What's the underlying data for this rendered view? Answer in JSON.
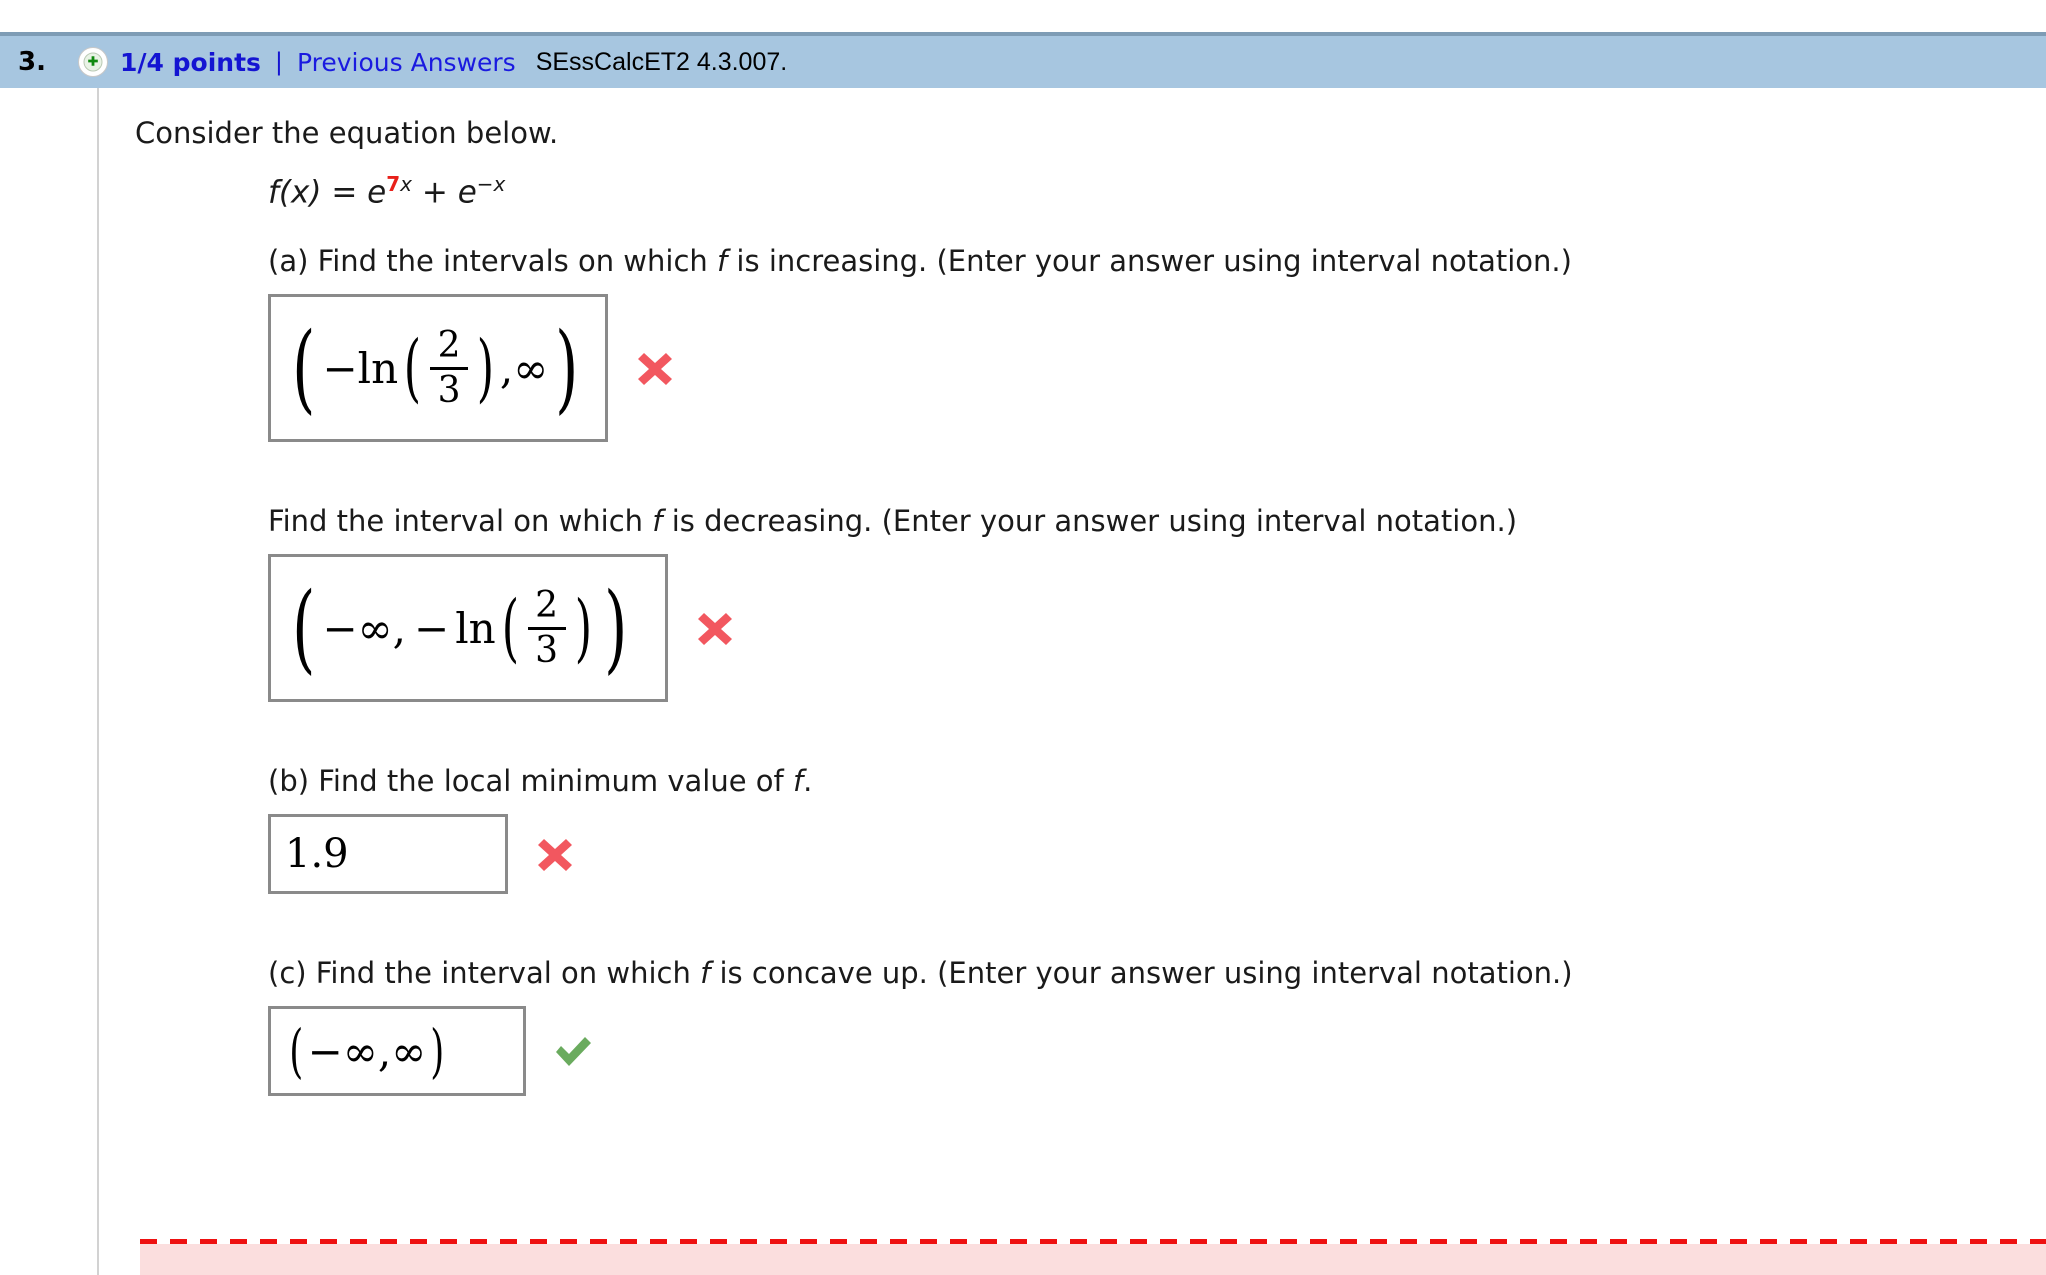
{
  "header": {
    "question_number": "3.",
    "points_icon": "plus-circle-icon",
    "points_label": "1/4 points",
    "separator": "|",
    "previous_answers_link": "Previous Answers",
    "assignment_code": "SEssCalcET2 4.3.007.",
    "background_color": "#a7c6e0",
    "link_color": "#1a1ae0"
  },
  "problem": {
    "intro": "Consider the equation below.",
    "equation": {
      "lhs": "f(x)",
      "equals": "=",
      "term1_base": "e",
      "term1_exponent_coefficient": "7",
      "term1_exponent_variable": "x",
      "plus": "+",
      "term2_base": "e",
      "term2_exponent": "−x",
      "highlight_color": "#e8201a",
      "full_text": "f(x) = e7x + e−x"
    }
  },
  "parts": [
    {
      "id": "a",
      "prompt_prefix": "(a) Find the intervals on which ",
      "prompt_var": "f",
      "prompt_suffix": " is increasing. (Enter your answer using interval notation.)",
      "answer": {
        "display": "(−ln(2/3),∞)",
        "left_paren": "(",
        "minus": "−",
        "ln": "ln",
        "fraction_numerator": "2",
        "fraction_denominator": "3",
        "comma": ",",
        "infinity": "∞",
        "right_paren": ")"
      },
      "grade_icon": "red-x-icon",
      "grade_status": "incorrect",
      "grade_color": "#f2575f"
    },
    {
      "id": "a2",
      "prompt_prefix": "Find the interval on which ",
      "prompt_var": "f",
      "prompt_suffix": " is decreasing. (Enter your answer using interval notation.)",
      "answer": {
        "display": "(−∞, −ln(2/3))",
        "left_paren": "(",
        "neg_infinity": "−∞",
        "comma": ",",
        "minus": "−",
        "ln": "ln",
        "fraction_numerator": "2",
        "fraction_denominator": "3",
        "right_paren": ")"
      },
      "grade_icon": "red-x-icon",
      "grade_status": "incorrect",
      "grade_color": "#f2575f"
    },
    {
      "id": "b",
      "prompt_prefix": "(b) Find the local minimum value of ",
      "prompt_var": "f",
      "prompt_suffix": ".",
      "answer": {
        "display": "1.9",
        "value": "1.9"
      },
      "grade_icon": "red-x-icon",
      "grade_status": "incorrect",
      "grade_color": "#f2575f"
    },
    {
      "id": "c",
      "prompt_prefix": "(c) Find the interval on which ",
      "prompt_var": "f",
      "prompt_suffix": " is concave up. (Enter your answer using interval notation.)",
      "answer": {
        "display": "(−∞,∞)",
        "left_paren": "(",
        "neg_infinity": "−∞",
        "comma": ",",
        "infinity": "∞",
        "right_paren": ")"
      },
      "grade_icon": "green-check-icon",
      "grade_status": "correct",
      "grade_color": "#6aab5e"
    }
  ],
  "footer": {
    "divider_style": "red-dashed",
    "divider_color": "#ee1111",
    "strip_color": "#fbdede"
  }
}
